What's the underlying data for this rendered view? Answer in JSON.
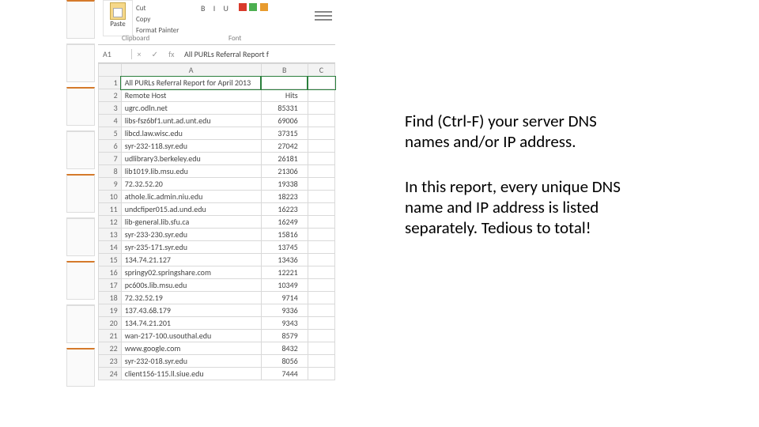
{
  "ribbon": {
    "paste_label": "Paste",
    "cut_label": "Cut",
    "copy_label": "Copy",
    "painter_label": "Format Painter",
    "group_clipboard": "Clipboard",
    "group_font": "Font",
    "biu": "B  I  U"
  },
  "formula_bar": {
    "namebox": "A1",
    "fx_label": "fx",
    "value": "All PURLs Referral Report f"
  },
  "columns": {
    "a": "A",
    "b": "B",
    "c": "C"
  },
  "rows": [
    {
      "n": 1,
      "a": "All PURLs Referral Report for April 2013",
      "b": ""
    },
    {
      "n": 2,
      "a": "Remote Host",
      "b": "Hits"
    },
    {
      "n": 3,
      "a": "ugrc.odln.net",
      "b": "85331"
    },
    {
      "n": 4,
      "a": "libs-fsz6bf1.unt.ad.unt.edu",
      "b": "69006"
    },
    {
      "n": 5,
      "a": "libcd.law.wisc.edu",
      "b": "37315"
    },
    {
      "n": 6,
      "a": "syr-232-118.syr.edu",
      "b": "27042"
    },
    {
      "n": 7,
      "a": "udlibrary3.berkeley.edu",
      "b": "26181"
    },
    {
      "n": 8,
      "a": "lib1019.lib.msu.edu",
      "b": "21306"
    },
    {
      "n": 9,
      "a": "72.32.52.20",
      "b": "19338"
    },
    {
      "n": 10,
      "a": "athole.lic.admin.niu.edu",
      "b": "18223"
    },
    {
      "n": 11,
      "a": "undcfiper015.ad.und.edu",
      "b": "16223"
    },
    {
      "n": 12,
      "a": "lib-general.lib.sfu.ca",
      "b": "16249"
    },
    {
      "n": 13,
      "a": "syr-233-230.syr.edu",
      "b": "15816"
    },
    {
      "n": 14,
      "a": "syr-235-171.syr.edu",
      "b": "13745"
    },
    {
      "n": 15,
      "a": "134.74.21.127",
      "b": "13436"
    },
    {
      "n": 16,
      "a": "springy02.springshare.com",
      "b": "12221"
    },
    {
      "n": 17,
      "a": "pc600s.lib.msu.edu",
      "b": "10349"
    },
    {
      "n": 18,
      "a": "72.32.52.19",
      "b": "9714"
    },
    {
      "n": 19,
      "a": "137.43.68.179",
      "b": "9336"
    },
    {
      "n": 20,
      "a": "134.74.21.201",
      "b": "9343"
    },
    {
      "n": 21,
      "a": "wan-217-100.usouthal.edu",
      "b": "8579"
    },
    {
      "n": 22,
      "a": "www.google.com",
      "b": "8432"
    },
    {
      "n": 23,
      "a": "syr-232-018.syr.edu",
      "b": "8056"
    },
    {
      "n": 24,
      "a": "client156-115.ll.siue.edu",
      "b": "7444"
    }
  ],
  "text": {
    "p1": "Find (Ctrl-F) your server DNS names and/or IP address.",
    "p2": "In this report, every unique DNS name and IP address is listed separately.  Tedious to total!"
  }
}
